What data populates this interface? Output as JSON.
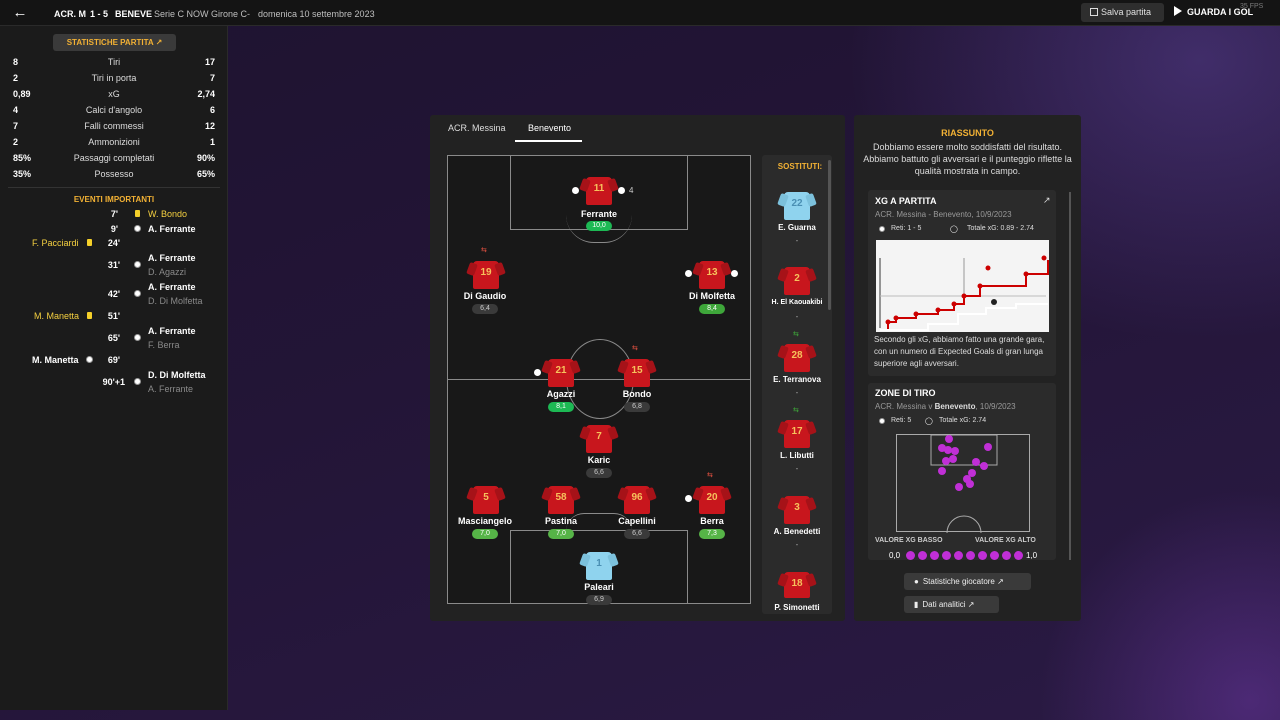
{
  "topbar": {
    "home_abbr": "ACR. M",
    "score": "1 - 5",
    "away_abbr": "BENEVE",
    "competition": "Serie C NOW Girone C",
    "sep": "-",
    "date": "domenica 10 settembre 2023",
    "save_label": "Salva partita",
    "goals_label": "GUARDA I GOL",
    "fps": "35 FPS"
  },
  "stats": {
    "header": "STATISTICHE PARTITA",
    "rows": [
      {
        "home": "8",
        "label": "Tiri",
        "away": "17"
      },
      {
        "home": "2",
        "label": "Tiri in porta",
        "away": "7"
      },
      {
        "home": "0,89",
        "label": "xG",
        "away": "2,74"
      },
      {
        "home": "4",
        "label": "Calci d'angolo",
        "away": "6"
      },
      {
        "home": "7",
        "label": "Falli commessi",
        "away": "12"
      },
      {
        "home": "2",
        "label": "Ammonizioni",
        "away": "1"
      },
      {
        "home": "85%",
        "label": "Passaggi completati",
        "away": "90%"
      },
      {
        "home": "35%",
        "label": "Possesso",
        "away": "65%"
      }
    ]
  },
  "events": {
    "title": "EVENTI IMPORTANTI",
    "items": [
      {
        "minute": "7'",
        "home": "",
        "away": "W. Bondo",
        "sub": ""
      },
      {
        "minute": "9'",
        "home": "",
        "away": "A. Ferrante",
        "sub": ""
      },
      {
        "minute": "24'",
        "home": "F. Pacciardi",
        "away": "",
        "sub": ""
      },
      {
        "minute": "31'",
        "home": "",
        "away": "A. Ferrante",
        "sub": "D. Agazzi"
      },
      {
        "minute": "42'",
        "home": "",
        "away": "A. Ferrante",
        "sub": "D. Di Molfetta"
      },
      {
        "minute": "51'",
        "home": "M. Manetta",
        "away": "",
        "sub": ""
      },
      {
        "minute": "65'",
        "home": "",
        "away": "A. Ferrante",
        "sub": "F. Berra"
      },
      {
        "minute": "69'",
        "home": "M. Manetta",
        "away": "",
        "sub": ""
      },
      {
        "minute": "90'+1",
        "home": "",
        "away": "D. Di Molfetta",
        "sub": "A. Ferrante"
      }
    ]
  },
  "tabs": [
    "ACR. Messina",
    "Benevento"
  ],
  "lineup": [
    {
      "num": "11",
      "name": "Ferrante",
      "rating": "10,0",
      "extra": "4"
    },
    {
      "num": "19",
      "name": "Di Gaudio",
      "rating": "6,4"
    },
    {
      "num": "13",
      "name": "Di Molfetta",
      "rating": "8,4"
    },
    {
      "num": "21",
      "name": "Agazzi",
      "rating": "8,1"
    },
    {
      "num": "15",
      "name": "Bondo",
      "rating": "6,8"
    },
    {
      "num": "7",
      "name": "Karic",
      "rating": "6,6"
    },
    {
      "num": "5",
      "name": "Masciangelo",
      "rating": "7,0"
    },
    {
      "num": "58",
      "name": "Pastina",
      "rating": "7,0"
    },
    {
      "num": "96",
      "name": "Capellini",
      "rating": "6,6"
    },
    {
      "num": "20",
      "name": "Berra",
      "rating": "7,3"
    },
    {
      "num": "1",
      "name": "Paleari",
      "rating": "6,9"
    }
  ],
  "subs": {
    "title": "SOSTITUTI:",
    "items": [
      {
        "num": "22",
        "name": "E. Guarna",
        "dash": "-"
      },
      {
        "num": "2",
        "name": "H. El Kaouakibi",
        "dash": "-"
      },
      {
        "num": "28",
        "name": "E. Terranova",
        "dash": "-"
      },
      {
        "num": "17",
        "name": "L. Libutti",
        "dash": "-"
      },
      {
        "num": "3",
        "name": "A. Benedetti",
        "dash": "-"
      },
      {
        "num": "18",
        "name": "P. Simonetti",
        "dash": ""
      }
    ]
  },
  "summary": {
    "title": "RIASSUNTO",
    "text": "Dobbiamo essere molto soddisfatti del risultato. Abbiamo battuto gli avversari e il punteggio riflette la qualità mostrata in campo."
  },
  "xg_card": {
    "title": "XG A PARTITA",
    "subtitle": "ACR. Messina - Benevento, 10/9/2023",
    "goals": "Reti: 1 - 5",
    "total": "Totale xG: 0.89 - 2.74",
    "desc": "Secondo gli xG, abbiamo fatto una grande gara, con un numero di Expected Goals di gran lunga superiore agli avversari."
  },
  "zone_card": {
    "title": "ZONE DI TIRO",
    "subtitle_pre": "ACR. Messina v ",
    "subtitle_team": "Benevento",
    "subtitle_post": ", 10/9/2023",
    "goals": "Reti: 5",
    "total": "Totale xG: 2.74",
    "low": "VALORE XG BASSO",
    "high": "VALORE XG ALTO",
    "min": "0,0",
    "max": "1,0"
  },
  "buttons": {
    "player_stats": "Statistiche giocatore",
    "analytics": "Dati analitici"
  }
}
